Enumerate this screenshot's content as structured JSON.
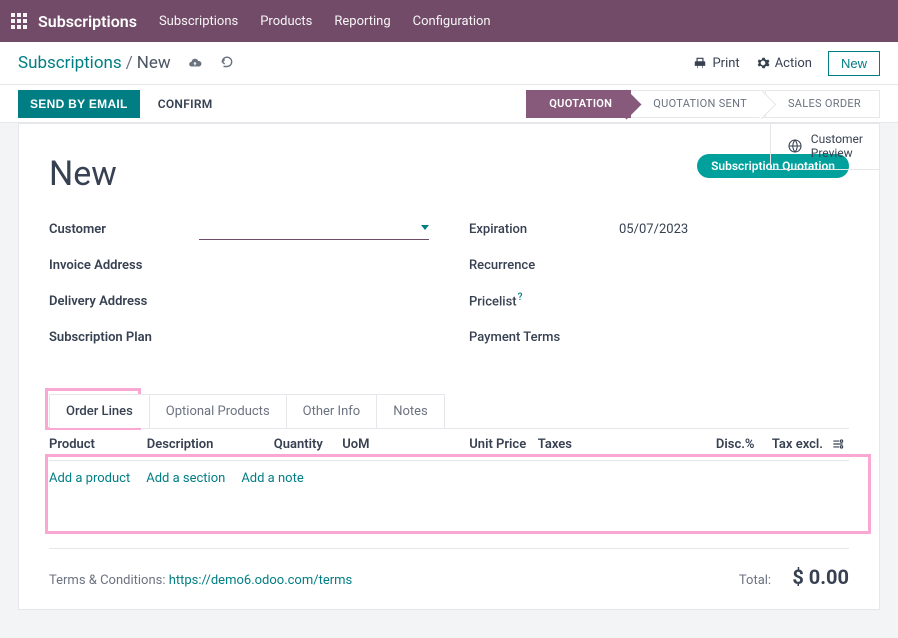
{
  "topbar": {
    "brand": "Subscriptions",
    "menu": [
      "Subscriptions",
      "Products",
      "Reporting",
      "Configuration"
    ]
  },
  "subbar": {
    "breadcrumb_root": "Subscriptions",
    "breadcrumb_current": "New",
    "print": "Print",
    "action": "Action",
    "new_button": "New"
  },
  "statusbar": {
    "send_email": "SEND BY EMAIL",
    "confirm": "CONFIRM",
    "stages": [
      "QUOTATION",
      "QUOTATION SENT",
      "SALES ORDER"
    ],
    "active_stage_index": 0
  },
  "sheet": {
    "customer_preview_l1": "Customer",
    "customer_preview_l2": "Preview",
    "title": "New",
    "badge": "Subscription Quotation",
    "left_fields": {
      "customer": "Customer",
      "invoice_address": "Invoice Address",
      "delivery_address": "Delivery Address",
      "subscription_plan": "Subscription Plan"
    },
    "right_fields": {
      "expiration": "Expiration",
      "expiration_value": "05/07/2023",
      "recurrence": "Recurrence",
      "pricelist": "Pricelist",
      "payment_terms": "Payment Terms"
    },
    "tabs": [
      "Order Lines",
      "Optional Products",
      "Other Info",
      "Notes"
    ],
    "active_tab_index": 0,
    "table": {
      "headers": {
        "product": "Product",
        "description": "Description",
        "quantity": "Quantity",
        "uom": "UoM",
        "unit_price": "Unit Price",
        "taxes": "Taxes",
        "disc": "Disc.%",
        "tax_excl": "Tax excl."
      },
      "add_product": "Add a product",
      "add_section": "Add a section",
      "add_note": "Add a note"
    },
    "terms_label": "Terms & Conditions: ",
    "terms_link": "https://demo6.odoo.com/terms",
    "total_label": "Total:",
    "total_value": "$ 0.00"
  }
}
